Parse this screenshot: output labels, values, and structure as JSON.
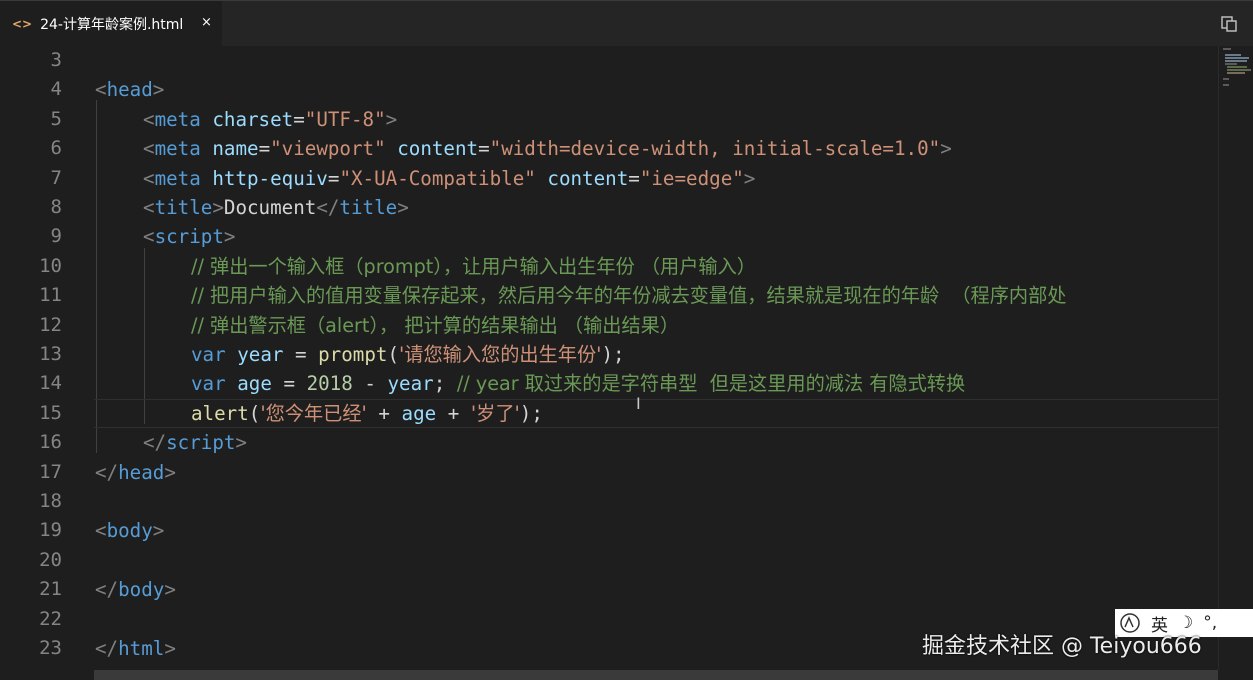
{
  "tab": {
    "icon": "<>",
    "title": "24-计算年龄案例.html",
    "close": "×"
  },
  "gutter": {
    "numbers": [
      "3",
      "4",
      "5",
      "6",
      "7",
      "8",
      "9",
      "10",
      "11",
      "12",
      "13",
      "14",
      "15",
      "16",
      "17",
      "18",
      "19",
      "20",
      "21",
      "22",
      "23"
    ]
  },
  "code": {
    "l4": {
      "open": "<",
      "tag": "head",
      "close": ">"
    },
    "l5": {
      "open": "<",
      "tag": "meta",
      "attr1": "charset",
      "eq1": "=",
      "val1": "\"UTF-8\"",
      "close": ">"
    },
    "l6": {
      "open": "<",
      "tag": "meta",
      "attr1": "name",
      "eq1": "=",
      "val1": "\"viewport\"",
      "attr2": "content",
      "eq2": "=",
      "val2": "\"width=device-width, initial-scale=1.0\"",
      "close": ">"
    },
    "l7": {
      "open": "<",
      "tag": "meta",
      "attr1": "http-equiv",
      "eq1": "=",
      "val1": "\"X-UA-Compatible\"",
      "attr2": "content",
      "eq2": "=",
      "val2": "\"ie=edge\"",
      "close": ">"
    },
    "l8": {
      "open": "<",
      "tag": "title",
      "close": ">",
      "text": "Document",
      "endopen": "</",
      "endtag": "title",
      "endclose": ">"
    },
    "l9": {
      "open": "<",
      "tag": "script",
      "close": ">"
    },
    "l10": {
      "comment": "// 弹出一个输入框（prompt），让用户输入出生年份 （用户输入）"
    },
    "l11": {
      "comment": "// 把用户输入的值用变量保存起来，然后用今年的年份减去变量值，结果就是现在的年龄  （程序内部处"
    },
    "l12": {
      "comment": "// 弹出警示框（alert）， 把计算的结果输出 （输出结果）"
    },
    "l13": {
      "kw": "var",
      "name": "year",
      "eq": "=",
      "fn": "prompt",
      "lp": "(",
      "str": "'请您输入您的出生年份'",
      "rp": ");"
    },
    "l14": {
      "kw": "var",
      "name": "age",
      "eq": "=",
      "num": "2018",
      "minus": "-",
      "var2": "year",
      "semi": ";",
      "comment": "// year 取过来的是字符串型  但是这里用的减法 有隐式转换"
    },
    "l15": {
      "fn": "alert",
      "lp": "(",
      "str1": "'您今年已经'",
      "plus1": "+",
      "var": "age",
      "plus2": "+",
      "str2": "'岁了'",
      "rp": ");"
    },
    "l16": {
      "open": "</",
      "tag": "script",
      "close": ">"
    },
    "l17": {
      "open": "</",
      "tag": "head",
      "close": ">"
    },
    "l19": {
      "open": "<",
      "tag": "body",
      "close": ">"
    },
    "l21": {
      "open": "</",
      "tag": "body",
      "close": ">"
    },
    "l23": {
      "open": "</",
      "tag": "html",
      "close": ">"
    }
  },
  "cursor_glyph": "I",
  "ime": {
    "label": "英",
    "moon": "☽",
    "punct": "°,"
  },
  "watermark": "掘金技术社区 @ Teiyou666"
}
